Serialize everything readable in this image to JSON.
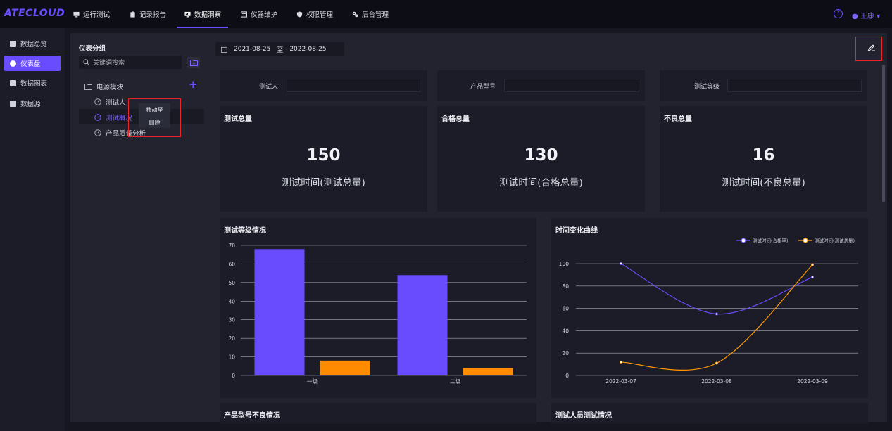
{
  "app": {
    "logo": "ATECLOUD",
    "user": "王康 ▾",
    "help": "?"
  },
  "topnav": [
    {
      "label": "运行测试",
      "icon": "monitor-icon"
    },
    {
      "label": "记录报告",
      "icon": "clipboard-icon"
    },
    {
      "label": "数据洞察",
      "icon": "insight-icon",
      "active": true
    },
    {
      "label": "仪器维护",
      "icon": "instrument-icon"
    },
    {
      "label": "权限管理",
      "icon": "shield-icon"
    },
    {
      "label": "后台管理",
      "icon": "gears-icon"
    }
  ],
  "sidenav": [
    {
      "label": "数据总览",
      "icon": "overview-icon"
    },
    {
      "label": "仪表盘",
      "icon": "dashboard-icon",
      "active": true
    },
    {
      "label": "数据图表",
      "icon": "chart-icon"
    },
    {
      "label": "数据源",
      "icon": "database-icon"
    }
  ],
  "tree": {
    "title": "仪表分组",
    "search_placeholder": "关键词搜索",
    "group": "电源模块",
    "items": [
      "测试人",
      "测试概况",
      "产品质量分析"
    ],
    "context_menu": [
      "移动至",
      "删除"
    ]
  },
  "date_range": {
    "start": "2021-08-25",
    "sep": "至",
    "end": "2022-08-25"
  },
  "filters": [
    {
      "label": "测试人",
      "value": ""
    },
    {
      "label": "产品型号",
      "value": ""
    },
    {
      "label": "测试等级",
      "value": ""
    }
  ],
  "kpis": [
    {
      "title": "测试总量",
      "value": "150",
      "caption": "测试时间(测试总量)"
    },
    {
      "title": "合格总量",
      "value": "130",
      "caption": "测试时间(合格总量)"
    },
    {
      "title": "不良总量",
      "value": "16",
      "caption": "测试时间(不良总量)"
    }
  ],
  "bottom_titles": [
    "产品型号不良情况",
    "测试人员测试情况"
  ],
  "colors": {
    "accent": "#6a4cff",
    "orange": "#ff8c00",
    "highlight": "#e8262c"
  },
  "chart_data": [
    {
      "type": "bar",
      "title": "测试等级情况",
      "categories": [
        "一级",
        "二级"
      ],
      "series": [
        {
          "values": [
            68,
            54
          ],
          "color": "#6a4cff"
        },
        {
          "values": [
            8,
            4
          ],
          "color": "#ff8c00"
        }
      ],
      "ylim": [
        0,
        70
      ],
      "yticks": [
        0,
        10,
        20,
        30,
        40,
        50,
        60,
        70
      ],
      "grid": true
    },
    {
      "type": "line",
      "title": "时间变化曲线",
      "categories": [
        "2022-03-07",
        "2022-03-08",
        "2022-03-09"
      ],
      "series": [
        {
          "name": "测试时间(合格率)",
          "values": [
            100,
            55,
            88
          ],
          "color": "#6a4cff"
        },
        {
          "name": "测试时间(测试总量)",
          "values": [
            12,
            11,
            99
          ],
          "color": "#ff9900"
        }
      ],
      "ylim": [
        0,
        100
      ],
      "yticks": [
        0,
        20,
        40,
        60,
        80,
        100
      ],
      "legend": "top-right",
      "grid": true
    }
  ]
}
